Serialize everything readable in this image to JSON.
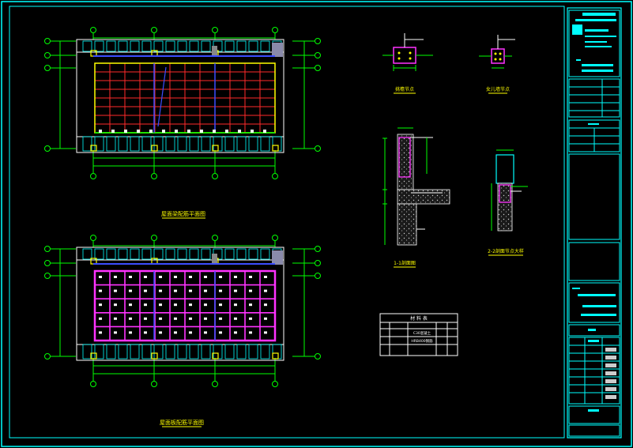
{
  "drawing": {
    "plan_top_title": "屋面梁配筋平面图",
    "plan_bottom_title": "屋面板配筋平面图",
    "detail_a_title": "挑檐节点",
    "detail_b_title": "女儿墙节点",
    "section_1_title": "1-1剖面图",
    "section_2_title": "2-2剖面节点大样",
    "table_title": "材 料 表",
    "table_rows": [
      "C30混凝土",
      "HRB400钢筋"
    ],
    "colors": {
      "frame": "#00ffff",
      "axis": "#00ff00",
      "beam_red": "#ff2a2a",
      "slab_magenta": "#ff33ff",
      "rebar_blue": "#3b4dff",
      "column_yellow": "#ffff00"
    }
  }
}
